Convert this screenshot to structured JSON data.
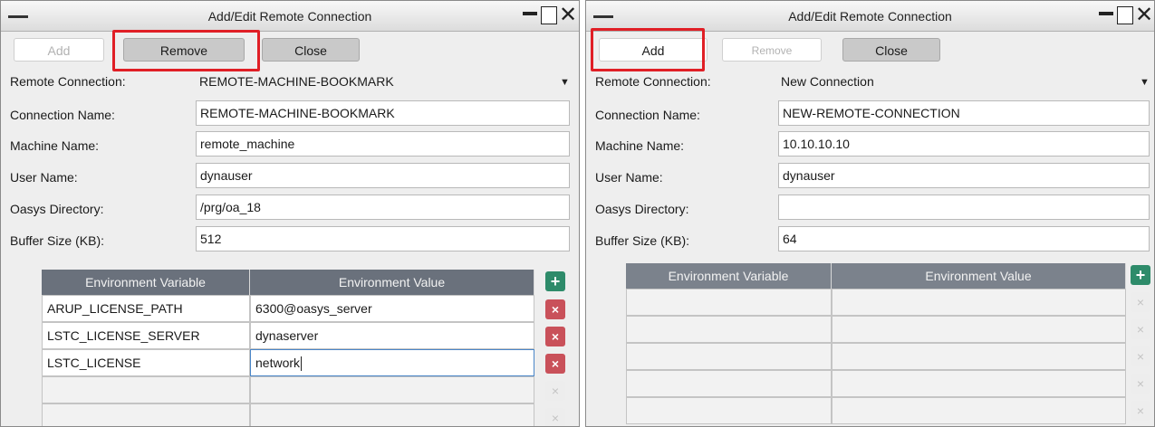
{
  "left": {
    "title": "Add/Edit Remote Connection",
    "buttons": {
      "add": "Add",
      "remove": "Remove",
      "close": "Close"
    },
    "fields": {
      "remote_connection_label": "Remote Connection:",
      "remote_connection_value": "REMOTE-MACHINE-BOOKMARK",
      "connection_name_label": "Connection Name:",
      "connection_name_value": "REMOTE-MACHINE-BOOKMARK",
      "machine_name_label": "Machine Name:",
      "machine_name_value": "remote_machine",
      "user_name_label": "User Name:",
      "user_name_value": "dynauser",
      "oasys_dir_label": "Oasys Directory:",
      "oasys_dir_value": "/prg/oa_18",
      "buffer_label": "Buffer Size (KB):",
      "buffer_value": "512"
    },
    "table": {
      "headers": [
        "Environment Variable",
        "Environment Value"
      ],
      "rows": [
        [
          "ARUP_LICENSE_PATH",
          "6300@oasys_server"
        ],
        [
          "LSTC_LICENSE_SERVER",
          "dynaserver"
        ],
        [
          "LSTC_LICENSE",
          "network"
        ],
        [
          "",
          ""
        ],
        [
          "",
          ""
        ]
      ]
    }
  },
  "right": {
    "title": "Add/Edit Remote Connection",
    "buttons": {
      "add": "Add",
      "remove": "Remove",
      "close": "Close"
    },
    "fields": {
      "remote_connection_label": "Remote Connection:",
      "remote_connection_value": "New Connection",
      "connection_name_label": "Connection Name:",
      "connection_name_value": "NEW-REMOTE-CONNECTION",
      "machine_name_label": "Machine Name:",
      "machine_name_value": "10.10.10.10",
      "user_name_label": "User Name:",
      "user_name_value": "dynauser",
      "oasys_dir_label": "Oasys Directory:",
      "oasys_dir_value": "",
      "buffer_label": "Buffer Size (KB):",
      "buffer_value": "64"
    },
    "table": {
      "headers": [
        "Environment Variable",
        "Environment Value"
      ],
      "rows": [
        [
          "",
          ""
        ],
        [
          "",
          ""
        ],
        [
          "",
          ""
        ],
        [
          "",
          ""
        ],
        [
          "",
          ""
        ]
      ]
    }
  },
  "icons": {
    "add_row": "+",
    "delete_row": "×",
    "dropdown": "▼",
    "close_window": "✕"
  },
  "colors": {
    "highlight": "#e01f26",
    "table_header": "#6a717c",
    "add_row": "#2e8b6a",
    "delete_row": "#c9515a"
  }
}
